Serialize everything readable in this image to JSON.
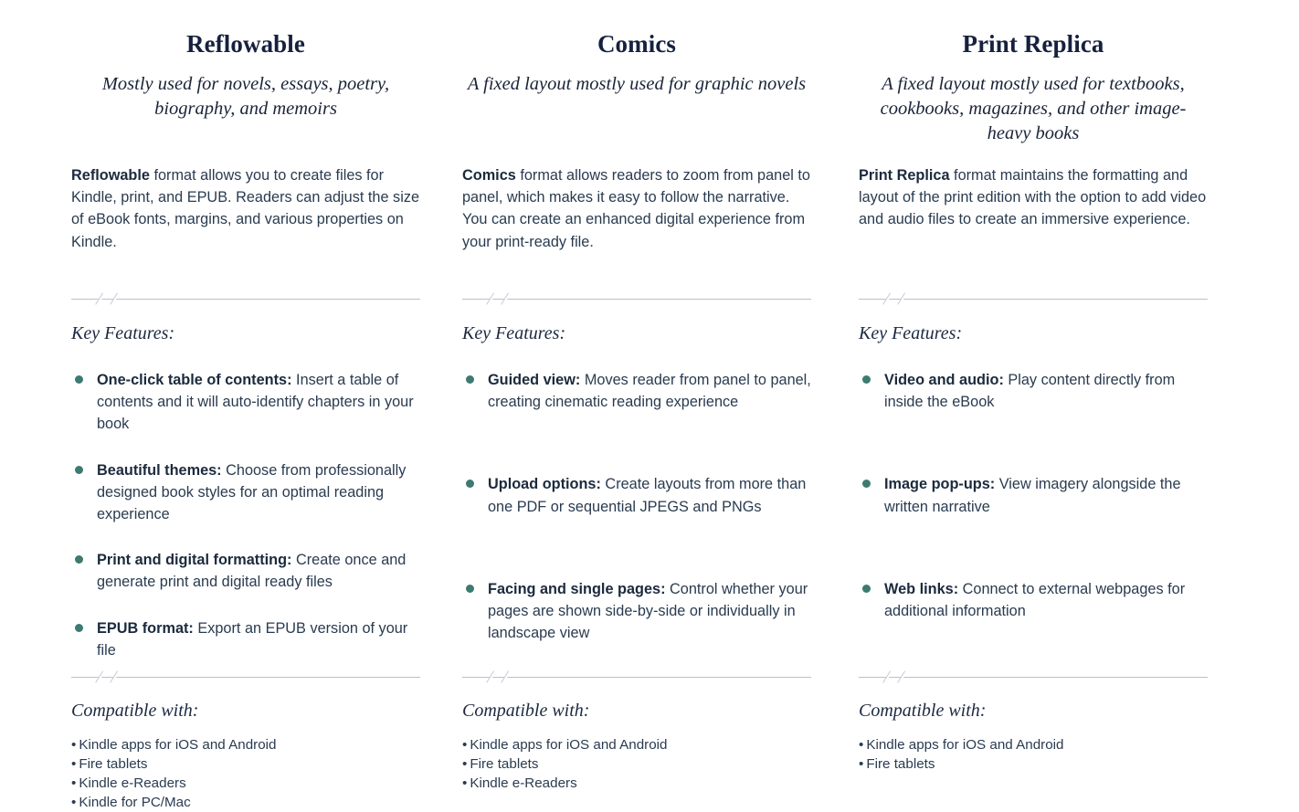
{
  "page": {
    "background_color": "#ffffff",
    "heading_color": "#16213e",
    "body_color": "#2a3b50",
    "bullet_color": "#3d7a71",
    "divider_color": "#b9c0cc"
  },
  "columns": [
    {
      "title": "Reflowable",
      "subtitle": "Mostly used for novels, essays, poetry, biography, and memoirs",
      "description_lead": "Reflowable",
      "description_rest": " format allows you to create files for Kindle, print, and EPUB. Readers can adjust the size of eBook fonts, margins, and various properties on Kindle.",
      "features_label": "Key Features:",
      "features": [
        {
          "title": "One-click table of contents:",
          "text": " Insert a table of contents and it will auto-identify chapters in your book"
        },
        {
          "title": "Beautiful themes:",
          "text": " Choose from professionally designed book styles for an optimal reading experience"
        },
        {
          "title": "Print and digital formatting:",
          "text": " Create once and generate print and digital ready files"
        },
        {
          "title": "EPUB format:",
          "text": " Export an EPUB version of your file"
        }
      ],
      "compatible_label": "Compatible with:",
      "compatible": [
        "Kindle apps for iOS and Android",
        "Fire tablets",
        "Kindle e-Readers",
        "Kindle for PC/Mac"
      ]
    },
    {
      "title": "Comics",
      "subtitle": "A fixed layout mostly used for graphic novels",
      "description_lead": "Comics",
      "description_rest": " format allows readers to zoom from panel to panel, which makes it easy to follow the narrative. You can create an enhanced digital experience from your print-ready file.",
      "features_label": "Key Features:",
      "features": [
        {
          "title": "Guided view:",
          "text": " Moves reader from panel to panel, creating cinematic reading experience"
        },
        {
          "title": "Upload options:",
          "text": " Create layouts from more than one PDF or sequential JPEGS and PNGs"
        },
        {
          "title": "Facing and single pages:",
          "text": " Control whether your pages are shown side-by-side or individually in landscape view"
        }
      ],
      "compatible_label": "Compatible with:",
      "compatible": [
        "Kindle apps for iOS and Android",
        "Fire tablets",
        "Kindle e-Readers"
      ]
    },
    {
      "title": "Print Replica",
      "subtitle": "A fixed layout mostly used for textbooks, cookbooks, magazines, and other image-heavy books",
      "description_lead": "Print Replica",
      "description_rest": " format maintains the formatting and layout of the print edition with the option to add video and audio files to create an immersive experience.",
      "features_label": "Key Features:",
      "features": [
        {
          "title": "Video and audio:",
          "text": " Play content directly from inside the eBook"
        },
        {
          "title": "Image pop-ups:",
          "text": " View imagery alongside the written narrative"
        },
        {
          "title": "Web links:",
          "text": " Connect to external webpages for additional information"
        }
      ],
      "compatible_label": "Compatible with:",
      "compatible": [
        "Kindle apps for iOS and Android",
        "Fire tablets"
      ]
    }
  ],
  "bullet_glyph": "•"
}
